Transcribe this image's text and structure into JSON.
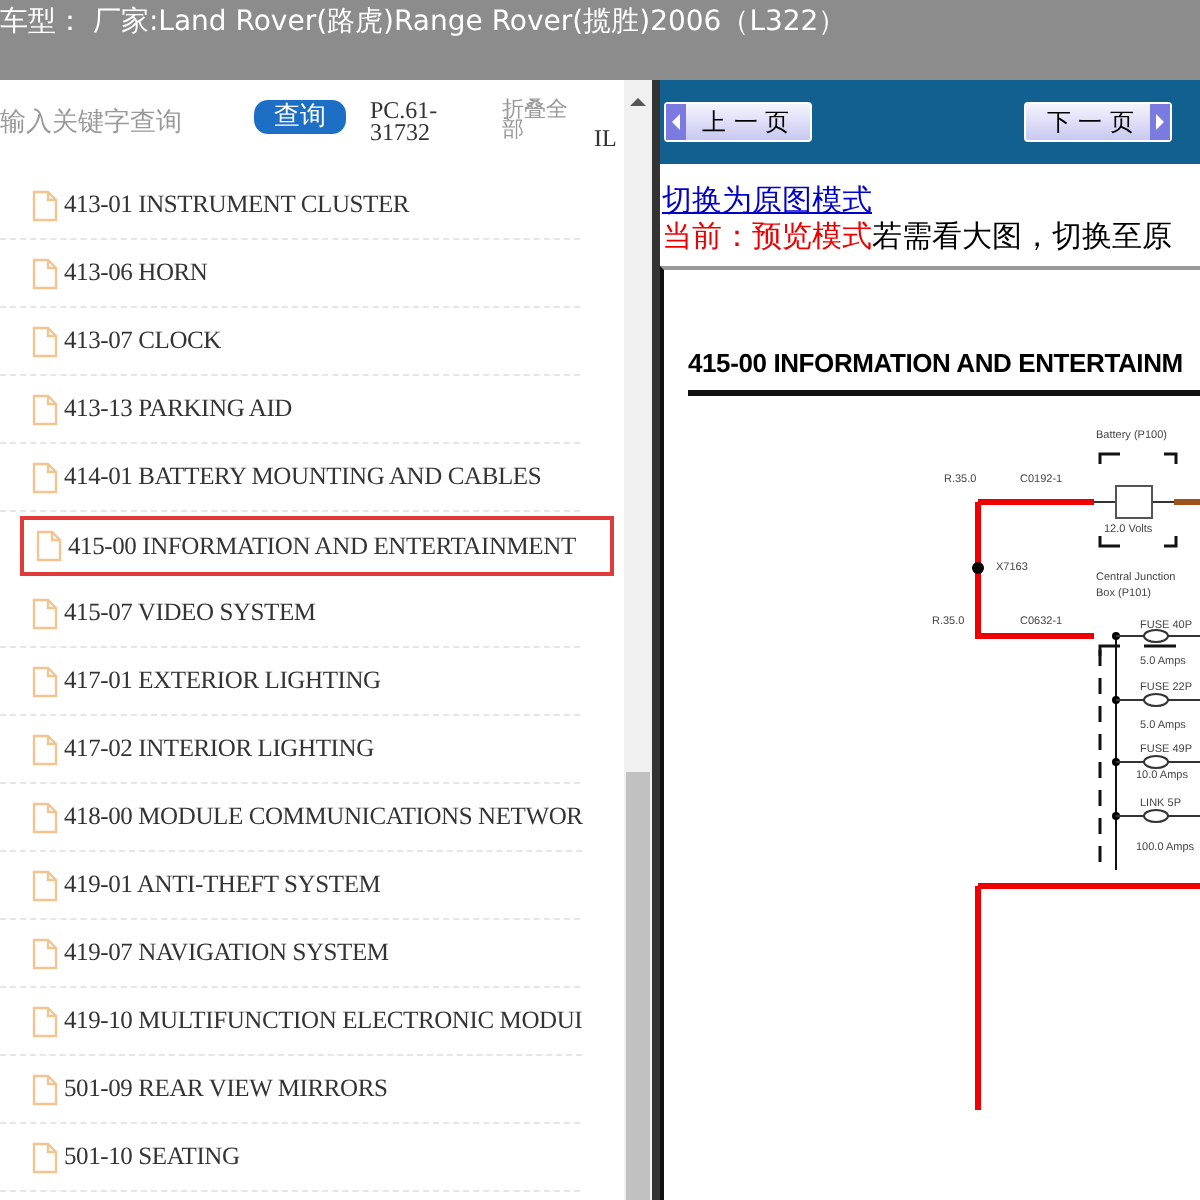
{
  "title_bar": {
    "title": "车型： 厂家:Land Rover(路虎)Range Rover(揽胜)2006（L322）"
  },
  "search": {
    "placeholder": "输入关键字查询",
    "button": "查询",
    "code": "PC.61-31732",
    "collapse_all": "折叠全部",
    "column_cut": "IL"
  },
  "toc": {
    "items": [
      {
        "label": "413-01 INSTRUMENT CLUSTER",
        "selected": false
      },
      {
        "label": "413-06 HORN",
        "selected": false
      },
      {
        "label": "413-07 CLOCK",
        "selected": false
      },
      {
        "label": "413-13 PARKING AID",
        "selected": false
      },
      {
        "label": "414-01 BATTERY MOUNTING AND CABLES",
        "selected": false
      },
      {
        "label": "415-00 INFORMATION AND ENTERTAINMENT",
        "selected": true
      },
      {
        "label": "415-07 VIDEO SYSTEM",
        "selected": false
      },
      {
        "label": "417-01 EXTERIOR LIGHTING",
        "selected": false
      },
      {
        "label": "417-02 INTERIOR LIGHTING",
        "selected": false
      },
      {
        "label": "418-00 MODULE COMMUNICATIONS NETWOR",
        "selected": false
      },
      {
        "label": "419-01 ANTI-THEFT SYSTEM",
        "selected": false
      },
      {
        "label": "419-07 NAVIGATION SYSTEM",
        "selected": false
      },
      {
        "label": "419-10 MULTIFUNCTION ELECTRONIC MODUI",
        "selected": false
      },
      {
        "label": "501-09 REAR VIEW MIRRORS",
        "selected": false
      },
      {
        "label": "501-10 SEATING",
        "selected": false
      }
    ]
  },
  "viewer": {
    "prev_button": "上 一 页",
    "next_button": "下 一 页",
    "switch_link": "切换为原图模式",
    "current_mode": "当前：预览模式",
    "hint": "若需看大图，切换至原",
    "diagram": {
      "heading": "415-00 INFORMATION AND ENTERTAINM",
      "labels": [
        {
          "text": "Battery (P100)"
        },
        {
          "text": "R.35.0"
        },
        {
          "text": "C0192-1"
        },
        {
          "text": "12.0 Volts"
        },
        {
          "text": "X7163"
        },
        {
          "text": "Central Junction"
        },
        {
          "text": "Box (P101)"
        },
        {
          "text": "R.35.0"
        },
        {
          "text": "C0632-1"
        },
        {
          "text": "FUSE 40P"
        },
        {
          "text": "5.0 Amps"
        },
        {
          "text": "FUSE 22P"
        },
        {
          "text": "5.0 Amps"
        },
        {
          "text": "FUSE 49P"
        },
        {
          "text": "10.0 Amps"
        },
        {
          "text": "LINK 5P"
        },
        {
          "text": "100.0 Amps"
        }
      ]
    }
  }
}
